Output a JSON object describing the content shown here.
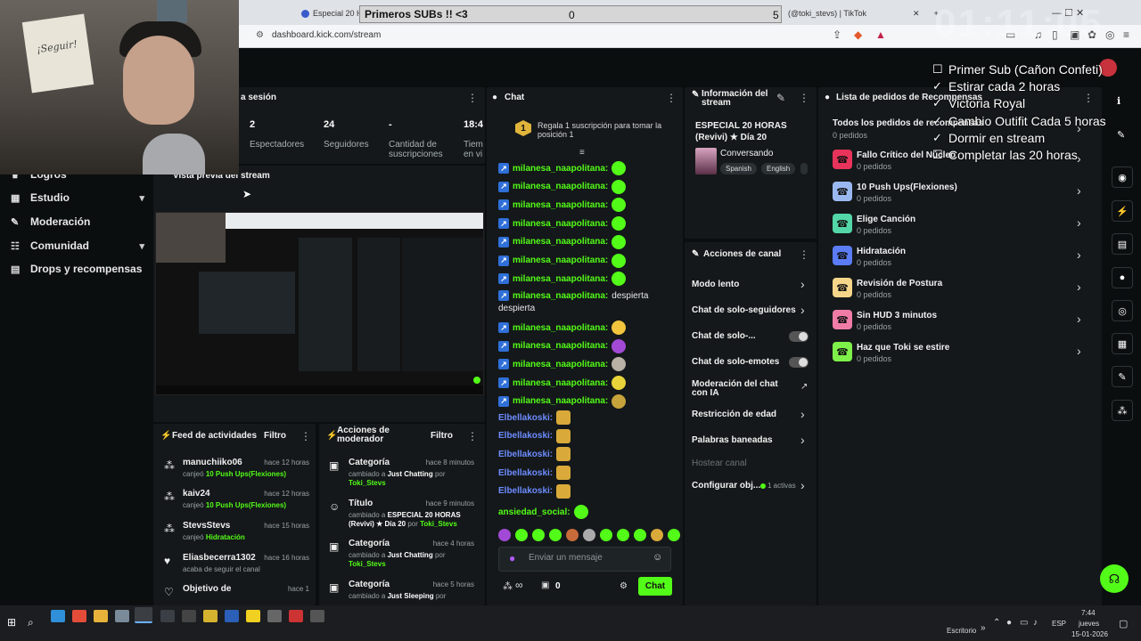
{
  "browser": {
    "tab1": "Especial 20 Ho",
    "tab2": "(@toki_stevs) | TikTok",
    "url": "dashboard.kick.com/stream"
  },
  "overlay": {
    "subs_title": "Primeros SUBs !! <3",
    "subs_current": "0",
    "subs_goal": "5",
    "clock": "01:11:05",
    "goals": [
      {
        "mark": "☐",
        "text": "Primer Sub (Cañon Confeti)"
      },
      {
        "mark": "✓",
        "text": "Estirar cada 2 horas"
      },
      {
        "mark": "✓",
        "text": "Victoria Royal"
      },
      {
        "mark": "✓",
        "text": "Cambio Outifit Cada 5 horas"
      },
      {
        "mark": "✓",
        "text": "Dormir en stream"
      },
      {
        "mark": "☐",
        "text": "Completar las 20 horas"
      }
    ],
    "sign_text": "¡Seguir!"
  },
  "sidebar": {
    "items": [
      {
        "label": "Logros",
        "icon": "trophy-icon"
      },
      {
        "label": "Estudio",
        "icon": "studio-icon",
        "chevron": "▾"
      },
      {
        "label": "Moderación",
        "icon": "wrench-icon"
      },
      {
        "label": "Comunidad",
        "icon": "community-icon",
        "chevron": "▾"
      },
      {
        "label": "Drops y recompensas",
        "icon": "drops-icon"
      }
    ]
  },
  "session": {
    "title": "a sesión",
    "stats": [
      {
        "value": "2",
        "label": "Espectadores"
      },
      {
        "value": "24",
        "label": "Seguidores"
      },
      {
        "value": "-",
        "label": "Cantidad de suscripciones"
      },
      {
        "value": "18:4",
        "label": "Tiem en vi"
      }
    ]
  },
  "preview": {
    "title": "Vista previa del stream"
  },
  "activity": {
    "title": "Feed de actividades",
    "filter": "Filtro",
    "items": [
      {
        "user": "manuchiiko06",
        "time": "hace 12 horas",
        "pre": "canjeó",
        "reward": "10 Push Ups(Flexiones)"
      },
      {
        "user": "kaiv24",
        "time": "hace 12 horas",
        "pre": "canjeó",
        "reward": "10 Push Ups(Flexiones)"
      },
      {
        "user": "StevsStevs",
        "time": "hace 15 horas",
        "pre": "canjeó",
        "reward": "Hidratación"
      },
      {
        "user": "Eliasbecerra1302",
        "time": "hace 16 horas",
        "pre": "acaba de seguir el canal",
        "reward": ""
      },
      {
        "user": "Objetivo de",
        "time": "hace 1",
        "pre": "",
        "reward": ""
      }
    ]
  },
  "modactions": {
    "title": "Acciones de moderador",
    "filter": "Filtro",
    "items": [
      {
        "title": "Categoría",
        "time": "hace 8 minutos",
        "pre": "cambiado a",
        "what": "Just Chatting",
        "by": "por",
        "user": "Toki_Stevs"
      },
      {
        "title": "Título",
        "time": "hace 9 minutos",
        "pre": "cambiado a",
        "what": "ESPECIAL 20 HORAS (Revivi) ★ Día 20",
        "by": "por",
        "user": "Toki_Stevs"
      },
      {
        "title": "Categoría",
        "time": "hace 4 horas",
        "pre": "cambiado a",
        "what": "Just Chatting",
        "by": "por",
        "user": "Toki_Stevs"
      },
      {
        "title": "Categoría",
        "time": "hace 5 horas",
        "pre": "cambiado a",
        "what": "Just Sleeping",
        "by": "por",
        "user": ""
      }
    ]
  },
  "chat": {
    "title": "Chat",
    "gift_text": "Regala 1 suscripción para tomar la posición 1",
    "gift_rank": "1",
    "lines": [
      {
        "user": "milanesa_naapolitana:",
        "msg": "",
        "emote": "green",
        "badge": true
      },
      {
        "user": "milanesa_naapolitana:",
        "msg": "",
        "emote": "green",
        "badge": true
      },
      {
        "user": "milanesa_naapolitana:",
        "msg": "",
        "emote": "green",
        "badge": true
      },
      {
        "user": "milanesa_naapolitana:",
        "msg": "",
        "emote": "green",
        "badge": true
      },
      {
        "user": "milanesa_naapolitana:",
        "msg": "",
        "emote": "green",
        "badge": true
      },
      {
        "user": "milanesa_naapolitana:",
        "msg": "",
        "emote": "green",
        "badge": true
      },
      {
        "user": "milanesa_naapolitana:",
        "msg": "",
        "emote": "green",
        "badge": true
      }
    ],
    "long_user": "milanesa_naapolitana:",
    "long_msg": "despierta",
    "long_msg2": "despierta",
    "lines2": [
      {
        "user": "milanesa_naapolitana:",
        "color": "#f2c53d"
      },
      {
        "user": "milanesa_naapolitana:",
        "color": "#a24ad6"
      },
      {
        "user": "milanesa_naapolitana:",
        "color": "#b8b0a4"
      },
      {
        "user": "milanesa_naapolitana:",
        "color": "#e8d33a"
      },
      {
        "user": "milanesa_naapolitana:",
        "color": "#c6a33b"
      }
    ],
    "lines3": [
      {
        "user": "Elbellakoski:"
      },
      {
        "user": "Elbellakoski:"
      },
      {
        "user": "Elbellakoski:"
      },
      {
        "user": "Elbellakoski:"
      },
      {
        "user": "Elbellakoski:"
      }
    ],
    "last_user": "ansiedad_social:",
    "input_placeholder": "Enviar un mensaje",
    "infinity": "∞",
    "count": "0",
    "send_label": "Chat"
  },
  "info": {
    "title": "Información del stream",
    "stream_title": "ESPECIAL 20 HORAS (Revivi) ★ Día 20",
    "category": "Conversando",
    "tags": [
      "Spanish",
      "English"
    ]
  },
  "actions": {
    "title": "Acciones de canal",
    "items": [
      {
        "label": "Modo lento",
        "control": "arrow"
      },
      {
        "label": "Chat de solo-seguidores",
        "control": "arrow"
      },
      {
        "label": "Chat de solo-...",
        "control": "toggle"
      },
      {
        "label": "Chat de solo-emotes",
        "control": "toggle"
      },
      {
        "label": "Moderación del chat con IA",
        "control": "ext"
      },
      {
        "label": "Restricción de edad",
        "control": "arrow"
      },
      {
        "label": "Palabras baneadas",
        "control": "arrow"
      },
      {
        "label": "Hostear canal",
        "control": "none"
      },
      {
        "label": "Configurar obj...",
        "control": "arrow",
        "extra": "1 activas"
      }
    ]
  },
  "rewards": {
    "title": "Lista de pedidos de Recompensas",
    "all_title": "Todos los pedidos de recompensas",
    "all_sub": "0 pedidos",
    "items": [
      {
        "title": "Fallo Crítico del Núcleo",
        "sub": "0 pedidos",
        "color": "#e8335b"
      },
      {
        "title": "10 Push Ups(Flexiones)",
        "sub": "0 pedidos",
        "color": "#9ab8f0"
      },
      {
        "title": "Elige Canción",
        "sub": "0 pedidos",
        "color": "#53d6a8"
      },
      {
        "title": "Hidratación",
        "sub": "0 pedidos",
        "color": "#5b7cf5"
      },
      {
        "title": "Revisión de Postura",
        "sub": "0 pedidos",
        "color": "#f4d58a"
      },
      {
        "title": "Sin HUD 3 minutos",
        "sub": "0 pedidos",
        "color": "#f07ca6"
      },
      {
        "title": "Haz que Toki se estire",
        "sub": "0 pedidos",
        "color": "#7ff04a"
      }
    ]
  },
  "taskbar": {
    "desktop": "Escritorio",
    "lang": "ESP",
    "time": "7:44",
    "day": "jueves",
    "date": "15-01-2026"
  },
  "colors": {
    "kick_green": "#53fc18",
    "panel": "#14181a",
    "bg": "#0b0e0f"
  }
}
